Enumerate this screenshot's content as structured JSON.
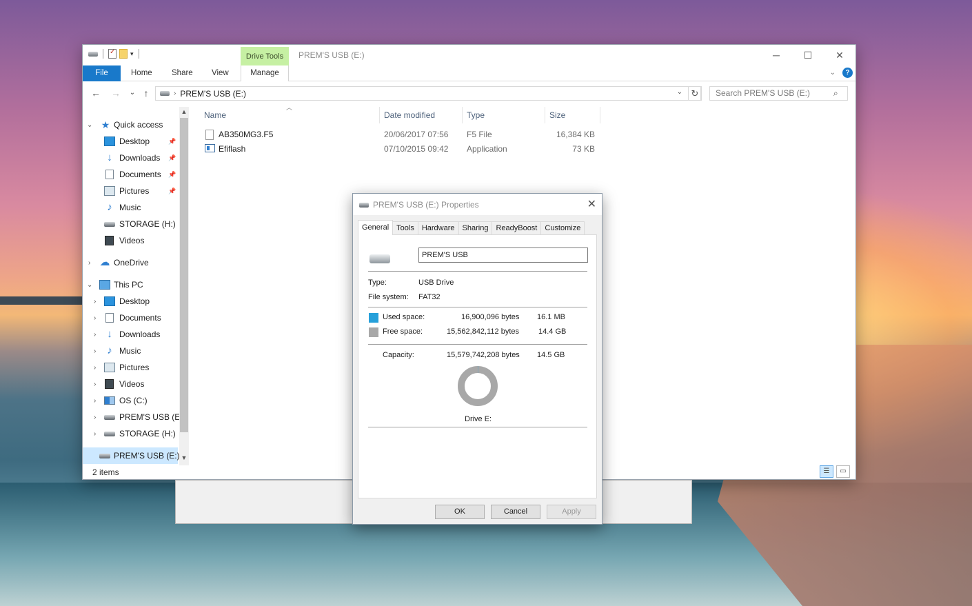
{
  "explorer": {
    "title": "PREM'S USB (E:)",
    "contextual_tab": "Drive Tools",
    "ribbon_tabs": [
      "File",
      "Home",
      "Share",
      "View",
      "Manage"
    ],
    "address": "PREM'S USB (E:)",
    "search_placeholder": "Search PREM'S USB (E:)",
    "help_label": "?",
    "nav": {
      "quick_access": "Quick access",
      "quick_items": [
        "Desktop",
        "Downloads",
        "Documents",
        "Pictures",
        "Music",
        "STORAGE (H:)",
        "Videos"
      ],
      "onedrive": "OneDrive",
      "this_pc": "This PC",
      "pc_items": [
        "Desktop",
        "Documents",
        "Downloads",
        "Music",
        "Pictures",
        "Videos",
        "OS (C:)",
        "PREM'S USB (E:)",
        "STORAGE (H:)"
      ],
      "selected": "PREM'S USB (E:)"
    },
    "columns": [
      "Name",
      "Date modified",
      "Type",
      "Size"
    ],
    "files": [
      {
        "name": "AB350MG3.F5",
        "date": "20/06/2017 07:56",
        "type": "F5 File",
        "size": "16,384 KB"
      },
      {
        "name": "Efiflash",
        "date": "07/10/2015 09:42",
        "type": "Application",
        "size": "73 KB"
      }
    ],
    "status": "2 items"
  },
  "dialog": {
    "title": "PREM'S USB (E:) Properties",
    "tabs": [
      "General",
      "Tools",
      "Hardware",
      "Sharing",
      "ReadyBoost",
      "Customize"
    ],
    "active_tab": "General",
    "drive_name": "PREM'S USB",
    "type_label": "Type:",
    "type_value": "USB Drive",
    "fs_label": "File system:",
    "fs_value": "FAT32",
    "used_label": "Used space:",
    "used_bytes": "16,900,096 bytes",
    "used_human": "16.1 MB",
    "free_label": "Free space:",
    "free_bytes": "15,562,842,112 bytes",
    "free_human": "14.4 GB",
    "cap_label": "Capacity:",
    "cap_bytes": "15,579,742,208 bytes",
    "cap_human": "14.5 GB",
    "drive_caption": "Drive E:",
    "used_fraction": 0.00108,
    "buttons": {
      "ok": "OK",
      "cancel": "Cancel",
      "apply": "Apply"
    },
    "colors": {
      "used": "#26a0da",
      "free": "#a8a8a8"
    }
  }
}
